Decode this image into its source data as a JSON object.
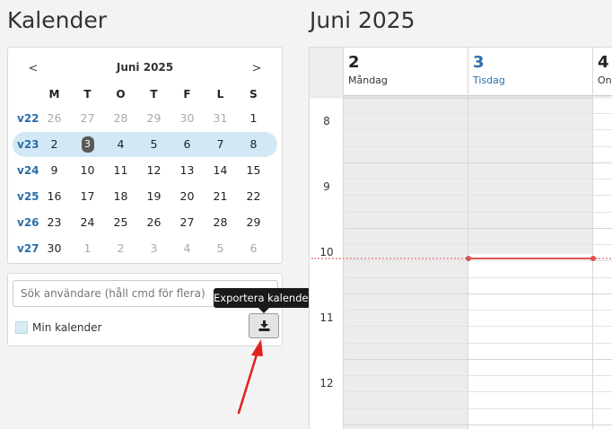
{
  "left_title": "Kalender",
  "right_title": "Juni 2025",
  "mini_calendar": {
    "prev": "<",
    "next": ">",
    "month": "Juni 2025",
    "dow": [
      "M",
      "T",
      "O",
      "T",
      "F",
      "L",
      "S"
    ],
    "weeks": [
      {
        "wk": "v22",
        "days": [
          "26",
          "27",
          "28",
          "29",
          "30",
          "31",
          "1"
        ]
      },
      {
        "wk": "v23",
        "days": [
          "2",
          "3",
          "4",
          "5",
          "6",
          "7",
          "8"
        ]
      },
      {
        "wk": "v24",
        "days": [
          "9",
          "10",
          "11",
          "12",
          "13",
          "14",
          "15"
        ]
      },
      {
        "wk": "v25",
        "days": [
          "16",
          "17",
          "18",
          "19",
          "20",
          "21",
          "22"
        ]
      },
      {
        "wk": "v26",
        "days": [
          "23",
          "24",
          "25",
          "26",
          "27",
          "28",
          "29"
        ]
      },
      {
        "wk": "v27",
        "days": [
          "30",
          "1",
          "2",
          "3",
          "4",
          "5",
          "6"
        ]
      }
    ]
  },
  "filter": {
    "search_placeholder": "Sök användare (håll cmd för flera)",
    "my_calendar_label": "Min kalender",
    "export_tooltip": "Exportera kalender"
  },
  "week_view": {
    "days": [
      {
        "num": "2",
        "name": "Måndag"
      },
      {
        "num": "3",
        "name": "Tisdag"
      },
      {
        "num": "4",
        "name": "Ons"
      }
    ],
    "hours": [
      "8",
      "9",
      "10",
      "11",
      "12"
    ]
  },
  "colors": {
    "accent": "#2a6eab",
    "current_week": "#d3e8f5",
    "now_line": "#d9534f",
    "arrow": "#e0201f"
  }
}
